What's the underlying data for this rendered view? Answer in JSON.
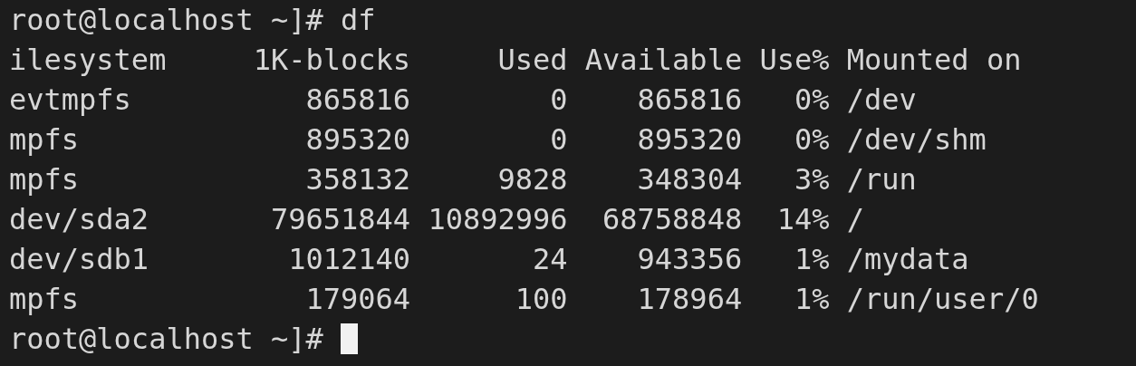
{
  "terminal": {
    "command_line": {
      "prompt": "root@localhost ~]#",
      "command": "df"
    },
    "table": {
      "columns": [
        "ilesystem",
        "1K-blocks",
        "Used",
        "Available",
        "Use%",
        "Mounted on"
      ],
      "rows": [
        [
          "evtmpfs",
          "865816",
          "0",
          "865816",
          "0%",
          "/dev"
        ],
        [
          "mpfs",
          "895320",
          "0",
          "895320",
          "0%",
          "/dev/shm"
        ],
        [
          "mpfs",
          "358132",
          "9828",
          "348304",
          "3%",
          "/run"
        ],
        [
          "dev/sda2",
          "79651844",
          "10892996",
          "68758848",
          "14%",
          "/"
        ],
        [
          "dev/sdb1",
          "1012140",
          "24",
          "943356",
          "1%",
          "/mydata"
        ],
        [
          "mpfs",
          "179064",
          "100",
          "178964",
          "1%",
          "/run/user/0"
        ]
      ]
    },
    "prompt_line": {
      "prompt": "root@localhost ~]#",
      "cursor": true
    }
  }
}
